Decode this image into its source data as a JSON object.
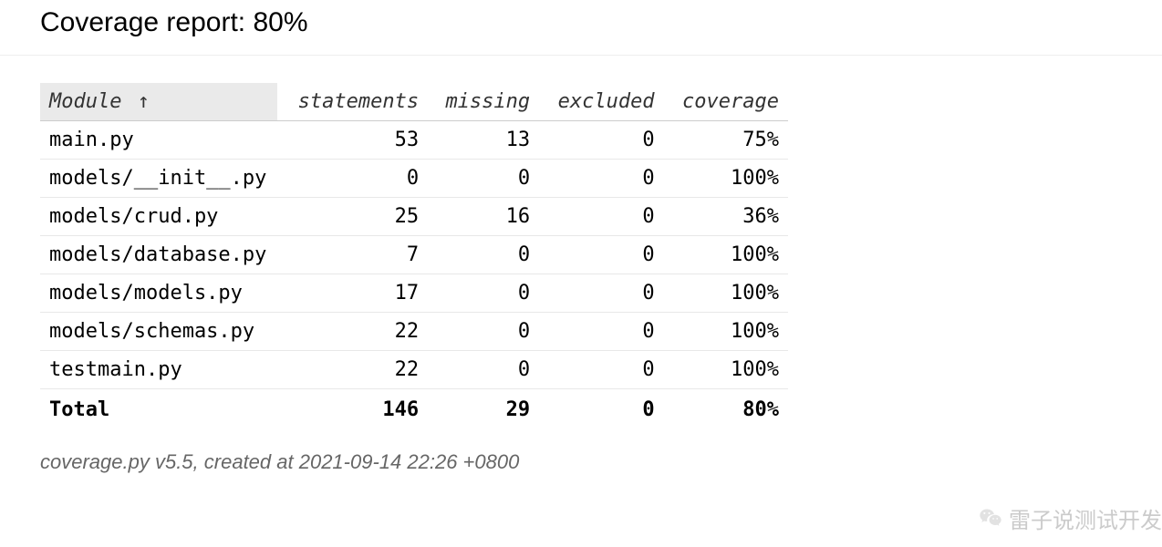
{
  "header": {
    "title": "Coverage report: 80%"
  },
  "columns": {
    "module": "Module",
    "statements": "statements",
    "missing": "missing",
    "excluded": "excluded",
    "coverage": "coverage",
    "sort_indicator": "↑"
  },
  "rows": [
    {
      "module": "main.py",
      "statements": "53",
      "missing": "13",
      "excluded": "0",
      "coverage": "75%"
    },
    {
      "module": "models/__init__.py",
      "statements": "0",
      "missing": "0",
      "excluded": "0",
      "coverage": "100%"
    },
    {
      "module": "models/crud.py",
      "statements": "25",
      "missing": "16",
      "excluded": "0",
      "coverage": "36%"
    },
    {
      "module": "models/database.py",
      "statements": "7",
      "missing": "0",
      "excluded": "0",
      "coverage": "100%"
    },
    {
      "module": "models/models.py",
      "statements": "17",
      "missing": "0",
      "excluded": "0",
      "coverage": "100%"
    },
    {
      "module": "models/schemas.py",
      "statements": "22",
      "missing": "0",
      "excluded": "0",
      "coverage": "100%"
    },
    {
      "module": "testmain.py",
      "statements": "22",
      "missing": "0",
      "excluded": "0",
      "coverage": "100%"
    }
  ],
  "total": {
    "label": "Total",
    "statements": "146",
    "missing": "29",
    "excluded": "0",
    "coverage": "80%"
  },
  "footer": {
    "text": "coverage.py v5.5, created at 2021-09-14 22:26 +0800"
  },
  "watermark": {
    "text": "雷子说测试开发"
  }
}
